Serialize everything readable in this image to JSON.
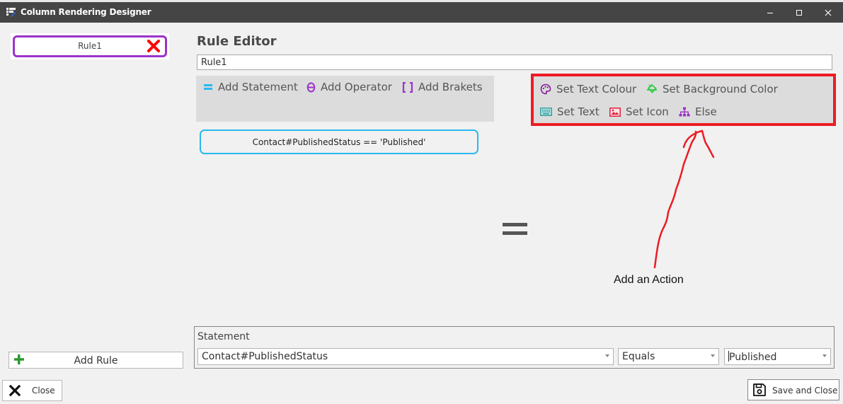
{
  "window": {
    "title": "Column Rendering Designer",
    "controls": {
      "minimize": "minimize",
      "maximize": "maximize",
      "close": "close"
    }
  },
  "sidebar": {
    "rules": [
      {
        "label": "Rule1",
        "delete_icon": "red-x-icon"
      }
    ],
    "add_rule_label": "Add Rule"
  },
  "editor": {
    "heading": "Rule Editor",
    "rule_name_value": "Rule1",
    "condition_toolbar": [
      {
        "label": "Add Statement",
        "icon": "equals-icon",
        "color": "#29b8f0"
      },
      {
        "label": "Add Operator",
        "icon": "theta-icon",
        "color": "#9a33c9"
      },
      {
        "label": "Add Brakets",
        "icon": "brackets-icon",
        "color": "#9a33c9"
      }
    ],
    "condition_expression": "Contact#PublishedStatus == 'Published'",
    "equals_symbol": "=",
    "action_toolbar": [
      {
        "label": "Set Text Colour",
        "icon": "palette-icon",
        "color": "#8a1a9a"
      },
      {
        "label": "Set Background Color",
        "icon": "paint-bucket-icon",
        "color": "#2ecc40"
      },
      {
        "label": "Set Text",
        "icon": "keyboard-icon",
        "color": "#2a9d9d"
      },
      {
        "label": "Set Icon",
        "icon": "image-icon",
        "color": "#e0203a"
      },
      {
        "label": "Else",
        "icon": "sitemap-icon",
        "color": "#9a33c9"
      }
    ]
  },
  "annotation": {
    "text": "Add an Action",
    "highlight_color": "#ec1c24"
  },
  "statement": {
    "legend": "Statement",
    "field_value": "Contact#PublishedStatus",
    "operator_value": "Equals",
    "comparison_value": "Published"
  },
  "footer": {
    "close_label": "Close",
    "save_label": "Save and Close"
  },
  "colors": {
    "titlebar": "#454545",
    "rule_border": "#9a33c9",
    "condition_border": "#29b8f0",
    "toolbar_bg": "#dcdcdc"
  }
}
